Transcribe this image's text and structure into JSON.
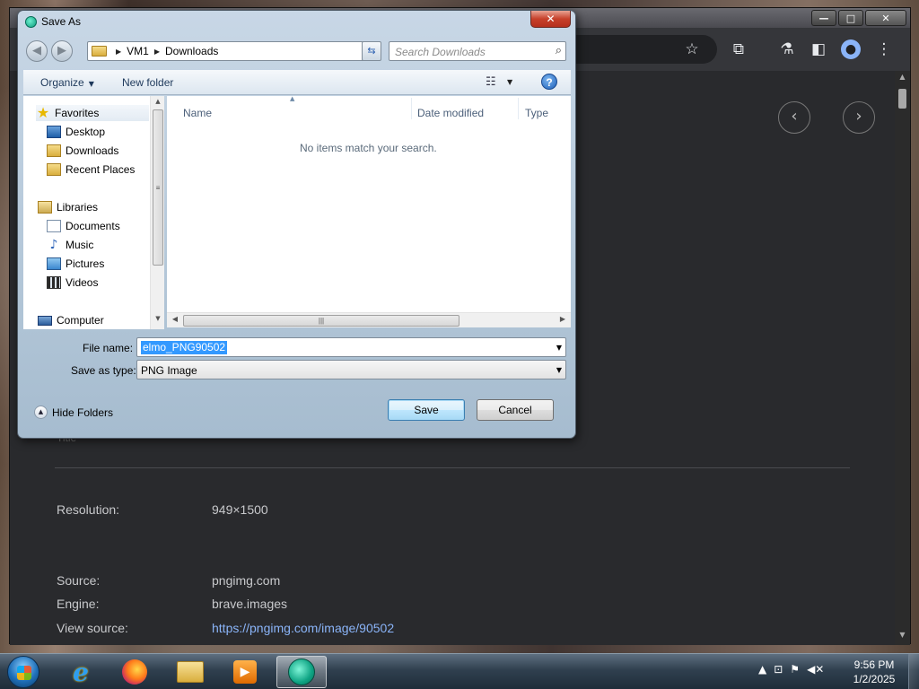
{
  "dialog": {
    "title": "Save As",
    "close_glyph": "✕",
    "back_glyph": "◀",
    "forward_glyph": "▶",
    "breadcrumb": [
      "VM1",
      "Downloads"
    ],
    "search_placeholder": "Search Downloads",
    "toolbar": {
      "organize": "Organize",
      "new_folder": "New folder",
      "help": "?"
    },
    "nav": {
      "favorites": "Favorites",
      "desktop": "Desktop",
      "downloads": "Downloads",
      "recent_places": "Recent Places",
      "libraries": "Libraries",
      "documents": "Documents",
      "music": "Music",
      "pictures": "Pictures",
      "videos": "Videos",
      "computer": "Computer"
    },
    "columns": {
      "name": "Name",
      "date_modified": "Date modified",
      "type": "Type"
    },
    "empty_message": "No items match your search.",
    "file_name_label": "File name:",
    "file_name_value": "elmo_PNG90502",
    "save_as_type_label": "Save as type:",
    "save_as_type_value": "PNG Image",
    "hide_folders": "Hide Folders",
    "save_button": "Save",
    "cancel_button": "Cancel"
  },
  "browser": {
    "window_buttons": {
      "minimize": "—",
      "maximize": "□",
      "close": "✕"
    },
    "image_info": {
      "partial_label": "Title",
      "resolution_label": "Resolution:",
      "resolution_value": "949×1500",
      "source_label": "Source:",
      "source_value": "pngimg.com",
      "engine_label": "Engine:",
      "engine_value": "brave.images",
      "view_source_label": "View source:",
      "view_source_value": "https://pngimg.com/image/90502"
    }
  },
  "taskbar": {
    "time": "9:56 PM",
    "date": "1/2/2025"
  },
  "colors": {
    "accent": "#3399ff",
    "link": "#8ab4f8",
    "dark_bg": "#292a2d"
  }
}
